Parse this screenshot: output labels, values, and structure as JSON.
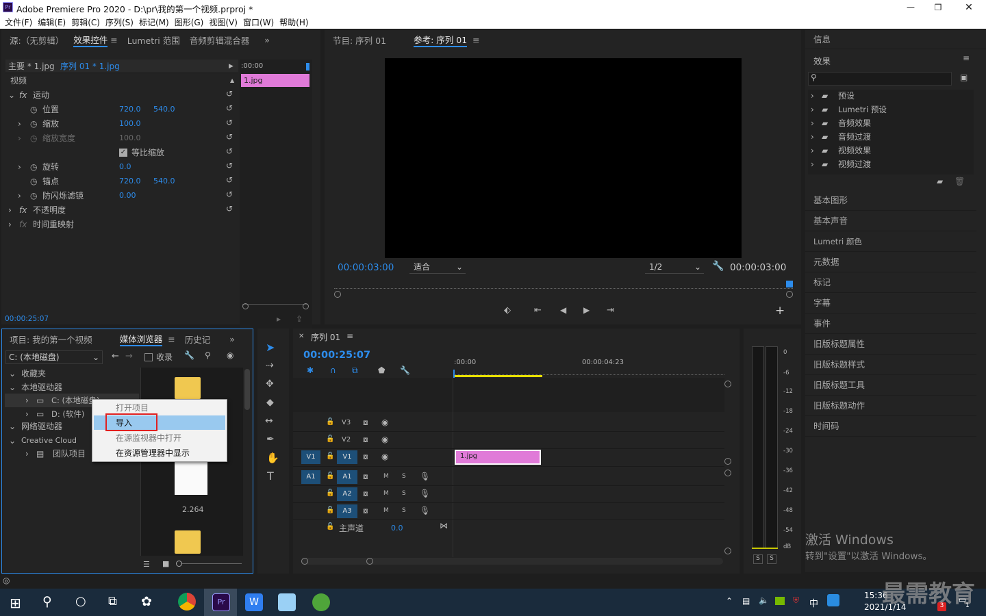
{
  "title": "Adobe Premiere Pro 2020 - D:\\pr\\我的第一个视频.prproj *",
  "menu": [
    "文件(F)",
    "编辑(E)",
    "剪辑(C)",
    "序列(S)",
    "标记(M)",
    "图形(G)",
    "视图(V)",
    "窗口(W)",
    "帮助(H)"
  ],
  "fx": {
    "tabs": [
      "源:（无剪辑）",
      "效果控件",
      "Lumetri 范围",
      "音频剪辑混合器"
    ],
    "master": "主要 * 1.jpg",
    "seq": "序列 01 * 1.jpg",
    "video": "视频",
    "time_start": ":00:00",
    "clip": "1.jpg",
    "motion": "运动",
    "pos": "位置",
    "pos_x": "720.0",
    "pos_y": "540.0",
    "scale": "缩放",
    "scale_v": "100.0",
    "scalew": "缩放宽度",
    "scalew_v": "100.0",
    "uniform": "等比缩放",
    "rot": "旋转",
    "rot_v": "0.0",
    "anchor": "锚点",
    "anchor_x": "720.0",
    "anchor_y": "540.0",
    "flicker": "防闪烁滤镜",
    "flicker_v": "0.00",
    "opacity": "不透明度",
    "remap": "时间重映射",
    "timecode": "00:00:25:07"
  },
  "program": {
    "tab1": "节目: 序列 01",
    "tab2": "参考: 序列 01",
    "tc_left": "00:00:03:00",
    "fit": "适合",
    "res": "1/2",
    "tc_right": "00:00:03:00"
  },
  "project": {
    "tabs": [
      "项目: 我的第一个视频",
      "媒体浏览器",
      "历史记"
    ],
    "drive": "C: (本地磁盘)",
    "ingest": "收录",
    "fav": "收藏夹",
    "local": "本地驱动器",
    "c": "C: (本地磁盘)",
    "d": "D: (软件)",
    "net": "网络驱动器",
    "cc": "Creative Cloud",
    "team": "团队项目",
    "thumb_label": "2.264",
    "ctx": [
      "打开项目",
      "导入",
      "在源监视器中打开",
      "在资源管理器中显示"
    ]
  },
  "timeline": {
    "tab": "序列 01",
    "tc": "00:00:25:07",
    "ruler0": ":00:00",
    "ruler1": "00:00:04:23",
    "v": [
      "V3",
      "V2",
      "V1"
    ],
    "a": [
      "A1",
      "A2",
      "A3"
    ],
    "src_v": "V1",
    "src_a": "A1",
    "clip": "1.jpg",
    "master": "主声道",
    "master_v": "0.0",
    "m": "M",
    "s": "S"
  },
  "meter": {
    "ticks": [
      "0",
      "-6",
      "-12",
      "-18",
      "-24",
      "-30",
      "-36",
      "-42",
      "-48",
      "-54",
      "dB"
    ],
    "s1": "S",
    "s2": "S"
  },
  "right": {
    "info": "信息",
    "effects": "效果",
    "folders": [
      "预设",
      "Lumetri 预设",
      "音频效果",
      "音频过渡",
      "视频效果",
      "视频过渡"
    ],
    "items": [
      "基本图形",
      "基本声音",
      "Lumetri 颜色",
      "元数据",
      "标记",
      "字幕",
      "事件",
      "旧版标题属性",
      "旧版标题样式",
      "旧版标题工具",
      "旧版标题动作",
      "时间码"
    ]
  },
  "watermark": {
    "l1": "激活 Windows",
    "l2": "转到\"设置\"以激活 Windows。",
    "brand": "最需教育"
  },
  "taskbar": {
    "time": "15:36",
    "date": "2021/1/14",
    "ime": "中",
    "badge": "3",
    "notif": "1"
  }
}
